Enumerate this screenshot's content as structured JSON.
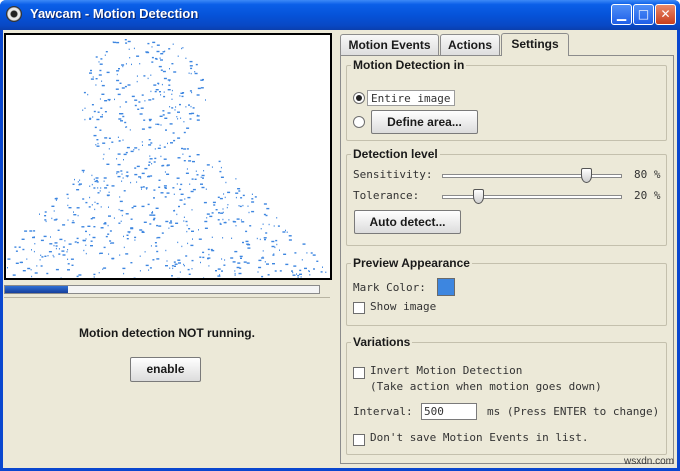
{
  "window": {
    "title": "Yawcam - Motion Detection",
    "icons": {
      "app": "webcam-icon",
      "minimize": "minimize-icon",
      "maximize": "maximize-icon",
      "close": "close-icon"
    }
  },
  "left_panel": {
    "status_text": "Motion detection NOT running.",
    "enable_label": "enable",
    "progress": 0.2
  },
  "tabs": [
    {
      "label": "Motion Events",
      "selected": false
    },
    {
      "label": "Actions",
      "selected": false
    },
    {
      "label": "Settings",
      "selected": true
    }
  ],
  "settings": {
    "motion_detection_in": {
      "title": "Motion Detection in",
      "entire_image_label": "Entire image",
      "define_area_label": "Define area...",
      "selected": "entire_image"
    },
    "detection_level": {
      "title": "Detection level",
      "sensitivity_label": "Sensitivity:",
      "sensitivity_value": 80,
      "sensitivity_text": "80 %",
      "tolerance_label": "Tolerance:",
      "tolerance_value": 20,
      "tolerance_text": "20 %",
      "auto_detect_label": "Auto detect..."
    },
    "preview_appearance": {
      "title": "Preview Appearance",
      "mark_color_label": "Mark Color:",
      "mark_color": "#3d86e0",
      "show_image_label": "Show image",
      "show_image_checked": false
    },
    "variations": {
      "title": "Variations",
      "invert_label": "Invert Motion Detection",
      "invert_note": "(Take action when motion goes down)",
      "invert_checked": false,
      "interval_label": "Interval:",
      "interval_value": "500",
      "interval_note": "ms (Press ENTER to change)",
      "dont_save_label": "Don't save Motion Events in list.",
      "dont_save_checked": false
    }
  },
  "watermark": "wsxdn.com"
}
